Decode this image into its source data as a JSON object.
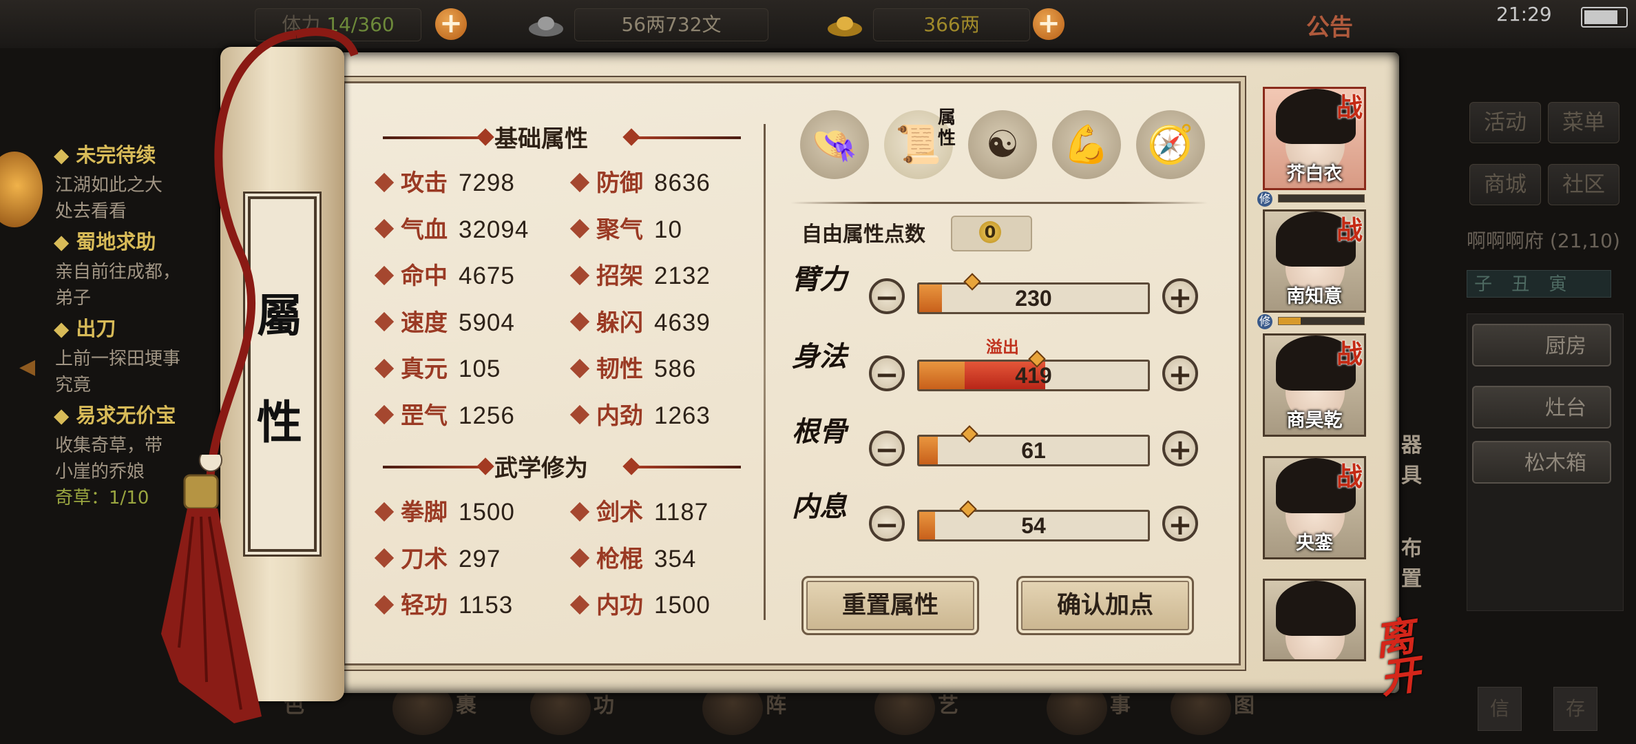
{
  "topbar": {
    "stamina_label": "体力",
    "stamina": "14/360",
    "silver": "56两732文",
    "gold": "366两",
    "notice": "公告",
    "clock": "21:29"
  },
  "quests": [
    {
      "title": "◆ 未完待续",
      "desc": [
        "江湖如此之大",
        "处去看看"
      ]
    },
    {
      "title": "◆ 蜀地求助",
      "desc": [
        "亲自前往成都，",
        "弟子"
      ]
    },
    {
      "title": "◆ 出刀",
      "desc": [
        "上前一探田埂事",
        "究竟"
      ]
    },
    {
      "title": "◆ 易求无价宝",
      "desc": [
        "收集奇草，带",
        "小崖的乔娘"
      ]
    }
  ],
  "quest_progress": "奇草：1/10",
  "scroll_title": [
    "屬",
    "性"
  ],
  "basic_section": "基础属性",
  "martial_section": "武学修为",
  "basic_stats": [
    {
      "label": "攻击",
      "value": "7298"
    },
    {
      "label": "防御",
      "value": "8636"
    },
    {
      "label": "气血",
      "value": "32094"
    },
    {
      "label": "聚气",
      "value": "10"
    },
    {
      "label": "命中",
      "value": "4675"
    },
    {
      "label": "招架",
      "value": "2132"
    },
    {
      "label": "速度",
      "value": "5904"
    },
    {
      "label": "躲闪",
      "value": "4639"
    },
    {
      "label": "真元",
      "value": "105"
    },
    {
      "label": "韧性",
      "value": "586"
    },
    {
      "label": "罡气",
      "value": "1256"
    },
    {
      "label": "内劲",
      "value": "1263"
    }
  ],
  "martial_stats": [
    {
      "label": "拳脚",
      "value": "1500"
    },
    {
      "label": "剑术",
      "value": "1187"
    },
    {
      "label": "刀术",
      "value": "297"
    },
    {
      "label": "枪棍",
      "value": "354"
    },
    {
      "label": "轻功",
      "value": "1153"
    },
    {
      "label": "内功",
      "value": "1500"
    }
  ],
  "category_tabs": [
    {
      "name": "hat-icon"
    },
    {
      "name": "scroll-icon",
      "label": "属性",
      "active": true
    },
    {
      "name": "bagua-icon"
    },
    {
      "name": "muscle-icon"
    },
    {
      "name": "compass-icon"
    }
  ],
  "free_points_label": "自由属性点数",
  "free_points": "0",
  "attributes": [
    {
      "name": "臂力",
      "value": "230",
      "fill": 0.1,
      "overflow": 0
    },
    {
      "name": "身法",
      "value": "419",
      "fill": 0.2,
      "overflow": 0.35
    },
    {
      "name": "根骨",
      "value": "61",
      "fill": 0.08,
      "overflow": 0
    },
    {
      "name": "内息",
      "value": "54",
      "fill": 0.07,
      "overflow": 0
    }
  ],
  "overflow_label": "溢出",
  "reset_button": "重置属性",
  "confirm_button": "确认加点",
  "party": [
    {
      "name": "芥白衣",
      "tag": "战",
      "active": true
    },
    {
      "name": "南知意",
      "tag": "战"
    },
    {
      "name": "商昊乾",
      "tag": "战"
    },
    {
      "name": "央銮",
      "tag": "战"
    },
    {
      "name": "",
      "tag": ""
    }
  ],
  "xiu_badge": "修",
  "side_tools": [
    "器",
    "具",
    "布",
    "置"
  ],
  "leave": "离开",
  "right_menu": {
    "buttons": [
      "活动",
      "菜单",
      "商城",
      "社区"
    ],
    "location": "啊啊啊府 (21,10)",
    "time_strip": "子 丑 寅",
    "facilities": [
      "厨房",
      "灶台",
      "松木箱"
    ],
    "bottom": [
      "信",
      "存"
    ]
  },
  "bottom_nav": [
    "角色",
    "包裹",
    "武功",
    "布阵",
    "技艺",
    "记事",
    "地图"
  ],
  "colors": {
    "accent": "#a5472f",
    "bar_fill": "#d87a2a",
    "overflow": "#c0321e",
    "parchment": "#ece1cb"
  }
}
